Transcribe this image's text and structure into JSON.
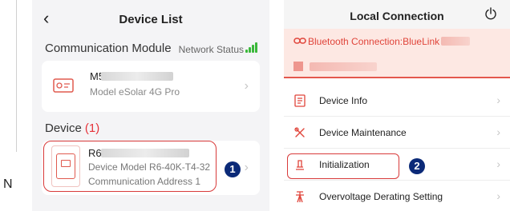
{
  "left_strip": {
    "letter": "N"
  },
  "device_list": {
    "title": "Device List",
    "back_icon": "chevron-left-icon",
    "comm_section": "Communication Module",
    "network_status_label": "Network Status",
    "signal_color": "#3bb83b",
    "module": {
      "name_visible": "M5",
      "model": "Model  eSolar 4G Pro"
    },
    "device_section": {
      "label": "Device",
      "count": "(1)"
    },
    "device": {
      "name_visible": "R6",
      "model": "Device Model R6-40K-T4-32",
      "address": "Communication Address  1"
    },
    "badge": "1"
  },
  "local_connection": {
    "title": "Local Connection",
    "power_icon": "power-icon",
    "bluetooth_text": "Bluetooth Connection:BlueLink",
    "accent": "#e0443a",
    "menu": [
      {
        "label": "Device Info",
        "icon": "document-icon"
      },
      {
        "label": "Device Maintenance",
        "icon": "tools-icon"
      },
      {
        "label": "Initialization",
        "icon": "reset-icon"
      },
      {
        "label": "Overvoltage Derating Setting",
        "icon": "tower-icon"
      }
    ],
    "badge": "2"
  }
}
